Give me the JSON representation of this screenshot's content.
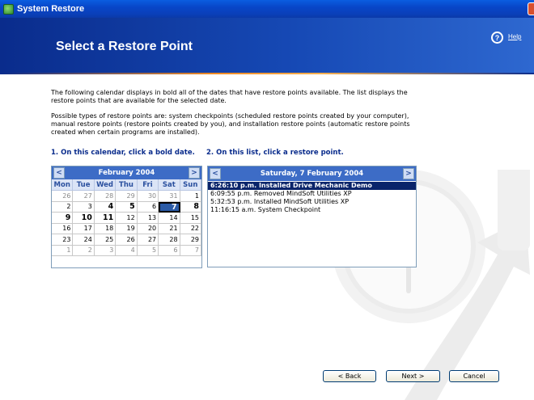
{
  "window": {
    "title": "System Restore"
  },
  "header": {
    "title": "Select a Restore Point",
    "help_label": "Help",
    "help_glyph": "?"
  },
  "intro": {
    "p1": "The following calendar displays in bold all of the dates that have restore points available. The list displays the restore points that are available for the selected date.",
    "p2": "Possible types of restore points are: system checkpoints (scheduled restore points created by your computer), manual restore points (restore points created by you), and installation restore points (automatic restore points created when certain programs are installed)."
  },
  "steps": {
    "step1": "1. On this calendar, click a bold date.",
    "step2": "2. On this list, click a restore point."
  },
  "calendar": {
    "month_label": "February 2004",
    "prev_glyph": "<",
    "next_glyph": ">",
    "days_of_week": [
      "Mon",
      "Tue",
      "Wed",
      "Thu",
      "Fri",
      "Sat",
      "Sun"
    ],
    "days": [
      {
        "d": "26",
        "other": true
      },
      {
        "d": "27",
        "other": true
      },
      {
        "d": "28",
        "other": true
      },
      {
        "d": "29",
        "other": true
      },
      {
        "d": "30",
        "other": true
      },
      {
        "d": "31",
        "other": true
      },
      {
        "d": "1"
      },
      {
        "d": "2"
      },
      {
        "d": "3"
      },
      {
        "d": "4",
        "bold": true
      },
      {
        "d": "5",
        "bold": true
      },
      {
        "d": "6"
      },
      {
        "d": "7",
        "bold": true,
        "selected": true
      },
      {
        "d": "8",
        "bold": true
      },
      {
        "d": "9",
        "bold": true
      },
      {
        "d": "10",
        "bold": true
      },
      {
        "d": "11",
        "bold": true
      },
      {
        "d": "12"
      },
      {
        "d": "13"
      },
      {
        "d": "14"
      },
      {
        "d": "15"
      },
      {
        "d": "16"
      },
      {
        "d": "17"
      },
      {
        "d": "18"
      },
      {
        "d": "19"
      },
      {
        "d": "20"
      },
      {
        "d": "21"
      },
      {
        "d": "22"
      },
      {
        "d": "23"
      },
      {
        "d": "24"
      },
      {
        "d": "25"
      },
      {
        "d": "26"
      },
      {
        "d": "27"
      },
      {
        "d": "28"
      },
      {
        "d": "29"
      },
      {
        "d": "1",
        "other": true
      },
      {
        "d": "2",
        "other": true
      },
      {
        "d": "3",
        "other": true
      },
      {
        "d": "4",
        "other": true
      },
      {
        "d": "5",
        "other": true
      },
      {
        "d": "6",
        "other": true
      },
      {
        "d": "7",
        "other": true
      }
    ]
  },
  "restore_list": {
    "date_label": "Saturday, 7 February 2004",
    "prev_glyph": "<",
    "next_glyph": ">",
    "items": [
      {
        "text": "6:26:10 p.m.  Installed Drive Mechanic Demo",
        "selected": true
      },
      {
        "text": "6:09:55 p.m.  Removed MindSoft Utilities XP"
      },
      {
        "text": "5:32:53 p.m.  Installed MindSoft Utilities XP"
      },
      {
        "text": "11:16:15 a.m.  System Checkpoint"
      }
    ]
  },
  "buttons": {
    "back": "< Back",
    "next": "Next >",
    "cancel": "Cancel"
  },
  "colors": {
    "header_dark": "#0a2c8c",
    "accent_orange": "#f08a24",
    "selection": "#0a246a"
  }
}
